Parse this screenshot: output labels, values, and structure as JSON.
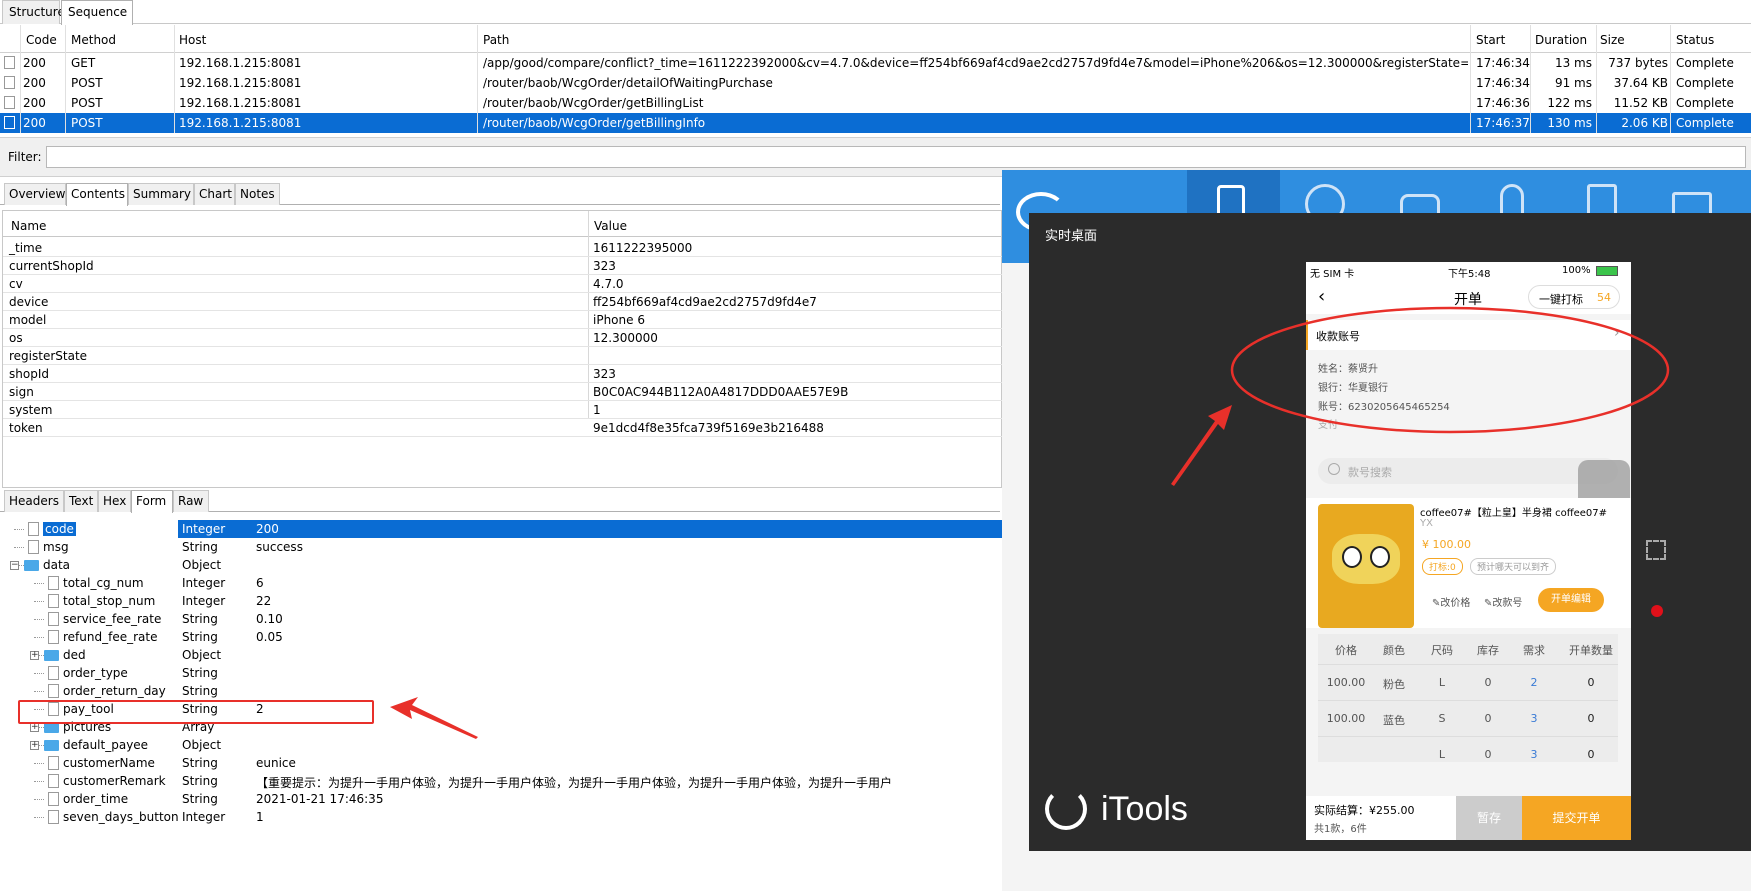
{
  "top_tabs": [
    "Structure",
    "Sequence"
  ],
  "columns": [
    "Code",
    "Method",
    "Host",
    "Path",
    "Start",
    "Duration",
    "Size",
    "Status"
  ],
  "requests": [
    {
      "code": "200",
      "method": "GET",
      "host": "192.168.1.215:8081",
      "path": "/app/good/compare/conflict?_time=1611222392000&cv=4.7.0&device=ff254bf669af4cd9ae2cd2757d9fd4e7&model=iPhone%206&os=12.300000&registerState=&sho...",
      "start": "17:46:34",
      "duration": "13 ms",
      "size": "737 bytes",
      "status": "Complete"
    },
    {
      "code": "200",
      "method": "POST",
      "host": "192.168.1.215:8081",
      "path": "/router/baob/WcgOrder/detailOfWaitingPurchase",
      "start": "17:46:34",
      "duration": "91 ms",
      "size": "37.64 KB",
      "status": "Complete"
    },
    {
      "code": "200",
      "method": "POST",
      "host": "192.168.1.215:8081",
      "path": "/router/baob/WcgOrder/getBillingList",
      "start": "17:46:36",
      "duration": "122 ms",
      "size": "11.52 KB",
      "status": "Complete"
    },
    {
      "code": "200",
      "method": "POST",
      "host": "192.168.1.215:8081",
      "path": "/router/baob/WcgOrder/getBillingInfo",
      "start": "17:46:37",
      "duration": "130 ms",
      "size": "2.06 KB",
      "status": "Complete"
    }
  ],
  "filter_label": "Filter:",
  "detail_tabs": [
    "Overview",
    "Contents",
    "Summary",
    "Chart",
    "Notes"
  ],
  "params_header": {
    "name": "Name",
    "value": "Value"
  },
  "params": [
    {
      "k": "_time",
      "v": "1611222395000"
    },
    {
      "k": "currentShopId",
      "v": "323"
    },
    {
      "k": "cv",
      "v": "4.7.0"
    },
    {
      "k": "device",
      "v": "ff254bf669af4cd9ae2cd2757d9fd4e7"
    },
    {
      "k": "model",
      "v": "iPhone 6"
    },
    {
      "k": "os",
      "v": "12.300000"
    },
    {
      "k": "registerState",
      "v": ""
    },
    {
      "k": "shopId",
      "v": "323"
    },
    {
      "k": "sign",
      "v": "B0C0AC944B112A0A4817DDD0AAE57E9B"
    },
    {
      "k": "system",
      "v": "1"
    },
    {
      "k": "token",
      "v": "9e1dcd4f8e35fca739f5169e3b216488"
    }
  ],
  "format_tabs": [
    "Headers",
    "Text",
    "Hex",
    "Form",
    "Raw"
  ],
  "tree": [
    {
      "n": "code",
      "t": "Integer",
      "v": "200",
      "lvl": 0,
      "kind": "file"
    },
    {
      "n": "msg",
      "t": "String",
      "v": "success",
      "lvl": 0,
      "kind": "file"
    },
    {
      "n": "data",
      "t": "Object",
      "v": "",
      "lvl": 0,
      "kind": "folder-open"
    },
    {
      "n": "total_cg_num",
      "t": "Integer",
      "v": "6",
      "lvl": 1,
      "kind": "file"
    },
    {
      "n": "total_stop_num",
      "t": "Integer",
      "v": "22",
      "lvl": 1,
      "kind": "file"
    },
    {
      "n": "service_fee_rate",
      "t": "String",
      "v": "0.10",
      "lvl": 1,
      "kind": "file"
    },
    {
      "n": "refund_fee_rate",
      "t": "String",
      "v": "0.05",
      "lvl": 1,
      "kind": "file"
    },
    {
      "n": "ded",
      "t": "Object",
      "v": "",
      "lvl": 1,
      "kind": "folder"
    },
    {
      "n": "order_type",
      "t": "String",
      "v": "",
      "lvl": 1,
      "kind": "file"
    },
    {
      "n": "order_return_day",
      "t": "String",
      "v": "",
      "lvl": 1,
      "kind": "file"
    },
    {
      "n": "pay_tool",
      "t": "String",
      "v": "2",
      "lvl": 1,
      "kind": "file"
    },
    {
      "n": "pictures",
      "t": "Array",
      "v": "",
      "lvl": 1,
      "kind": "folder"
    },
    {
      "n": "default_payee",
      "t": "Object",
      "v": "",
      "lvl": 1,
      "kind": "folder"
    },
    {
      "n": "customerName",
      "t": "String",
      "v": "eunice",
      "lvl": 1,
      "kind": "file"
    },
    {
      "n": "customerRemark",
      "t": "String",
      "v": "【重要提示：为提升一手用户体验，为提升一手用户体验，为提升一手用户体验，为提升一手用户体验，为提升一手用户",
      "lvl": 1,
      "kind": "file"
    },
    {
      "n": "order_time",
      "t": "String",
      "v": "2021-01-21 17:46:35",
      "lvl": 1,
      "kind": "file"
    },
    {
      "n": "seven_days_button",
      "t": "Integer",
      "v": "1",
      "lvl": 1,
      "kind": "file"
    }
  ],
  "itools": {
    "window_title": "实时桌面",
    "brand": "iTools",
    "accent": "#2f8ee0"
  },
  "phone": {
    "carrier": "无 SIM 卡",
    "time": "下午5:48",
    "battery": "100%",
    "title": "开单",
    "print_btn": "一键打标",
    "print_count": "54",
    "account_label": "收款账号",
    "name_line": "姓名：蔡贤升",
    "bank_line": "银行：华夏银行",
    "acct_line": "账号：6230205645465254",
    "pay_line": "支付",
    "search_placeholder": "款号搜索",
    "product_title": "coffee07#【粒上皇】半身裙  coffee07#",
    "product_sub": "YX",
    "price": "¥ 100.00",
    "tag1": "打标:0",
    "tag2": "预计哪天可以到齐",
    "edit_price": "改价格",
    "edit_no": "改款号",
    "edit_btn": "开单编辑",
    "table_head": [
      "价格",
      "颜色",
      "尺码",
      "库存",
      "需求",
      "开单数量"
    ],
    "table_rows": [
      [
        "100.00",
        "粉色",
        "L",
        "0",
        "2",
        "0"
      ],
      [
        "100.00",
        "蓝色",
        "S",
        "0",
        "3",
        "0"
      ],
      [
        "",
        "",
        "L",
        "0",
        "3",
        "0"
      ]
    ],
    "settle": "实际结算：¥255.00",
    "settle_sub": "共1款，6件",
    "save_btn": "暂存",
    "submit_btn": "提交开单",
    "accent": "#f5a623"
  }
}
